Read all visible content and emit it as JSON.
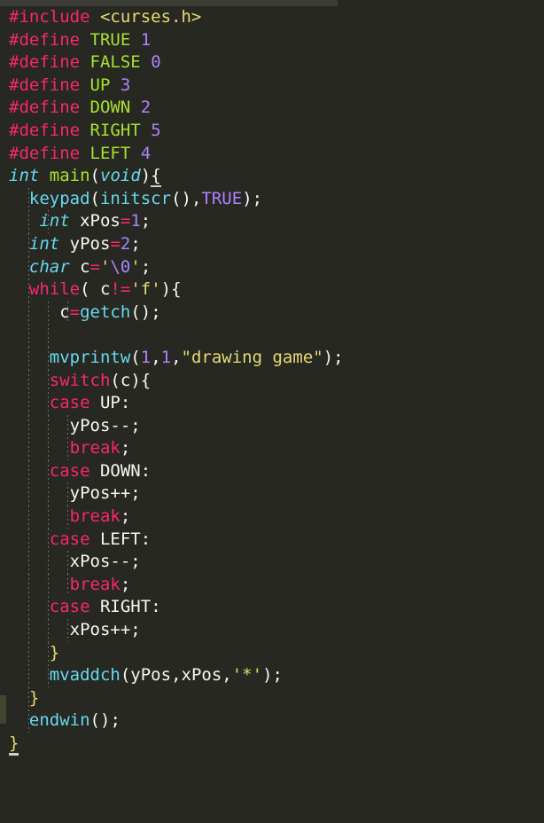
{
  "editor": {
    "theme_name": "monokai",
    "background_color": "#272822",
    "default_text_color": "#f8f8f2",
    "top_strip_color": "#3c3d36",
    "gutter_marker_color": "#43442f",
    "indent_guide_color": "#6e7066",
    "colors": {
      "keyword": "#f92672",
      "type": "#66d9ef",
      "macro_name": "#a6e22e",
      "number": "#ae81ff",
      "function": "#66d9ef",
      "function_def": "#a6e22e",
      "string": "#e6db74",
      "escape": "#ae81ff",
      "identifier": "#f8f8f2",
      "constant": "#ae81ff"
    },
    "language": "c"
  },
  "code": {
    "lines": [
      {
        "indent_guides": [],
        "tokens": [
          {
            "t": "#include",
            "c": "pre"
          },
          {
            "t": " ",
            "c": "id"
          },
          {
            "t": "<curses.h>",
            "c": "hdr"
          }
        ]
      },
      {
        "indent_guides": [],
        "tokens": [
          {
            "t": "#define",
            "c": "pre"
          },
          {
            "t": " ",
            "c": "id"
          },
          {
            "t": "TRUE",
            "c": "mac"
          },
          {
            "t": " ",
            "c": "id"
          },
          {
            "t": "1",
            "c": "num"
          }
        ]
      },
      {
        "indent_guides": [],
        "tokens": [
          {
            "t": "#define",
            "c": "pre"
          },
          {
            "t": " ",
            "c": "id"
          },
          {
            "t": "FALSE",
            "c": "mac"
          },
          {
            "t": " ",
            "c": "id"
          },
          {
            "t": "0",
            "c": "num"
          }
        ]
      },
      {
        "indent_guides": [],
        "tokens": [
          {
            "t": "#define",
            "c": "pre"
          },
          {
            "t": " ",
            "c": "id"
          },
          {
            "t": "UP",
            "c": "mac"
          },
          {
            "t": " ",
            "c": "id"
          },
          {
            "t": "3",
            "c": "num"
          }
        ]
      },
      {
        "indent_guides": [],
        "tokens": [
          {
            "t": "#define",
            "c": "pre"
          },
          {
            "t": " ",
            "c": "id"
          },
          {
            "t": "DOWN",
            "c": "mac"
          },
          {
            "t": " ",
            "c": "id"
          },
          {
            "t": "2",
            "c": "num"
          }
        ]
      },
      {
        "indent_guides": [],
        "tokens": [
          {
            "t": "#define",
            "c": "pre"
          },
          {
            "t": " ",
            "c": "id"
          },
          {
            "t": "RIGHT",
            "c": "mac"
          },
          {
            "t": " ",
            "c": "id"
          },
          {
            "t": "5",
            "c": "num"
          }
        ]
      },
      {
        "indent_guides": [],
        "tokens": [
          {
            "t": "#define",
            "c": "pre"
          },
          {
            "t": " ",
            "c": "id"
          },
          {
            "t": "LEFT",
            "c": "mac"
          },
          {
            "t": " ",
            "c": "id"
          },
          {
            "t": "4",
            "c": "num"
          }
        ]
      },
      {
        "indent_guides": [],
        "tokens": [
          {
            "t": "int",
            "c": "type"
          },
          {
            "t": " ",
            "c": "id"
          },
          {
            "t": "main",
            "c": "fndef"
          },
          {
            "t": "(",
            "c": "punct"
          },
          {
            "t": "void",
            "c": "type"
          },
          {
            "t": ")",
            "c": "punct"
          },
          {
            "t": "{",
            "c": "punct match"
          }
        ]
      },
      {
        "indent_guides": [
          22
        ],
        "tokens": [
          {
            "t": "  ",
            "c": "id"
          },
          {
            "t": "keypad",
            "c": "fn"
          },
          {
            "t": "(",
            "c": "punct"
          },
          {
            "t": "initscr",
            "c": "fn"
          },
          {
            "t": "(",
            "c": "punct"
          },
          {
            "t": ")",
            "c": "punct"
          },
          {
            "t": ",",
            "c": "punct"
          },
          {
            "t": "TRUE",
            "c": "const"
          },
          {
            "t": ")",
            "c": "punct"
          },
          {
            "t": ";",
            "c": "punct"
          }
        ]
      },
      {
        "indent_guides": [
          22,
          44
        ],
        "tokens": [
          {
            "t": "   ",
            "c": "id"
          },
          {
            "t": "int",
            "c": "type"
          },
          {
            "t": " ",
            "c": "id"
          },
          {
            "t": "xPos",
            "c": "id"
          },
          {
            "t": "=",
            "c": "op"
          },
          {
            "t": "1",
            "c": "num"
          },
          {
            "t": ";",
            "c": "punct"
          }
        ]
      },
      {
        "indent_guides": [
          22
        ],
        "tokens": [
          {
            "t": "  ",
            "c": "id"
          },
          {
            "t": "int",
            "c": "type"
          },
          {
            "t": " ",
            "c": "id"
          },
          {
            "t": "yPos",
            "c": "id"
          },
          {
            "t": "=",
            "c": "op"
          },
          {
            "t": "2",
            "c": "num"
          },
          {
            "t": ";",
            "c": "punct"
          }
        ]
      },
      {
        "indent_guides": [
          22
        ],
        "tokens": [
          {
            "t": "  ",
            "c": "id"
          },
          {
            "t": "char",
            "c": "type"
          },
          {
            "t": " ",
            "c": "id"
          },
          {
            "t": "c",
            "c": "id"
          },
          {
            "t": "=",
            "c": "op"
          },
          {
            "t": "'",
            "c": "str"
          },
          {
            "t": "\\0",
            "c": "esc"
          },
          {
            "t": "'",
            "c": "str"
          },
          {
            "t": ";",
            "c": "punct"
          }
        ]
      },
      {
        "indent_guides": [
          22
        ],
        "tokens": [
          {
            "t": "  ",
            "c": "id"
          },
          {
            "t": "while",
            "c": "kw"
          },
          {
            "t": "( ",
            "c": "punct"
          },
          {
            "t": "c",
            "c": "id"
          },
          {
            "t": "!=",
            "c": "op"
          },
          {
            "t": "'f'",
            "c": "str"
          },
          {
            "t": ")",
            "c": "punct"
          },
          {
            "t": "{",
            "c": "punct"
          }
        ]
      },
      {
        "indent_guides": [
          22,
          44,
          66
        ],
        "tokens": [
          {
            "t": "     ",
            "c": "id"
          },
          {
            "t": "c",
            "c": "id"
          },
          {
            "t": "=",
            "c": "op"
          },
          {
            "t": "getch",
            "c": "fn"
          },
          {
            "t": "(",
            "c": "punct"
          },
          {
            "t": ")",
            "c": "punct"
          },
          {
            "t": ";",
            "c": "punct"
          }
        ]
      },
      {
        "indent_guides": [
          22,
          44
        ],
        "tokens": []
      },
      {
        "indent_guides": [
          22,
          44
        ],
        "tokens": [
          {
            "t": "    ",
            "c": "id"
          },
          {
            "t": "mvprintw",
            "c": "fn"
          },
          {
            "t": "(",
            "c": "punct"
          },
          {
            "t": "1",
            "c": "num"
          },
          {
            "t": ",",
            "c": "punct"
          },
          {
            "t": "1",
            "c": "num"
          },
          {
            "t": ",",
            "c": "punct"
          },
          {
            "t": "\"drawing game\"",
            "c": "str"
          },
          {
            "t": ")",
            "c": "punct"
          },
          {
            "t": ";",
            "c": "punct"
          }
        ]
      },
      {
        "indent_guides": [
          22,
          44
        ],
        "tokens": [
          {
            "t": "    ",
            "c": "id"
          },
          {
            "t": "switch",
            "c": "kw"
          },
          {
            "t": "(",
            "c": "punct"
          },
          {
            "t": "c",
            "c": "id"
          },
          {
            "t": ")",
            "c": "punct"
          },
          {
            "t": "{",
            "c": "punct"
          }
        ]
      },
      {
        "indent_guides": [
          22,
          44
        ],
        "tokens": [
          {
            "t": "    ",
            "c": "id"
          },
          {
            "t": "case",
            "c": "kw"
          },
          {
            "t": " ",
            "c": "id"
          },
          {
            "t": "UP",
            "c": "id"
          },
          {
            "t": ":",
            "c": "punct"
          }
        ]
      },
      {
        "indent_guides": [
          22,
          44,
          66
        ],
        "tokens": [
          {
            "t": "      ",
            "c": "id"
          },
          {
            "t": "yPos",
            "c": "id"
          },
          {
            "t": "--",
            "c": "punct"
          },
          {
            "t": ";",
            "c": "punct"
          }
        ]
      },
      {
        "indent_guides": [
          22,
          44,
          66
        ],
        "tokens": [
          {
            "t": "      ",
            "c": "id"
          },
          {
            "t": "break",
            "c": "kw"
          },
          {
            "t": ";",
            "c": "punct"
          }
        ]
      },
      {
        "indent_guides": [
          22,
          44
        ],
        "tokens": [
          {
            "t": "    ",
            "c": "id"
          },
          {
            "t": "case",
            "c": "kw"
          },
          {
            "t": " ",
            "c": "id"
          },
          {
            "t": "DOWN",
            "c": "id"
          },
          {
            "t": ":",
            "c": "punct"
          }
        ]
      },
      {
        "indent_guides": [
          22,
          44,
          66
        ],
        "tokens": [
          {
            "t": "      ",
            "c": "id"
          },
          {
            "t": "yPos",
            "c": "id"
          },
          {
            "t": "++",
            "c": "punct"
          },
          {
            "t": ";",
            "c": "punct"
          }
        ]
      },
      {
        "indent_guides": [
          22,
          44,
          66
        ],
        "tokens": [
          {
            "t": "      ",
            "c": "id"
          },
          {
            "t": "break",
            "c": "kw"
          },
          {
            "t": ";",
            "c": "punct"
          }
        ]
      },
      {
        "indent_guides": [
          22,
          44
        ],
        "tokens": [
          {
            "t": "    ",
            "c": "id"
          },
          {
            "t": "case",
            "c": "kw"
          },
          {
            "t": " ",
            "c": "id"
          },
          {
            "t": "LEFT",
            "c": "id"
          },
          {
            "t": ":",
            "c": "punct"
          }
        ]
      },
      {
        "indent_guides": [
          22,
          44,
          66
        ],
        "tokens": [
          {
            "t": "      ",
            "c": "id"
          },
          {
            "t": "xPos",
            "c": "id"
          },
          {
            "t": "--",
            "c": "punct"
          },
          {
            "t": ";",
            "c": "punct"
          }
        ]
      },
      {
        "indent_guides": [
          22,
          44,
          66
        ],
        "tokens": [
          {
            "t": "      ",
            "c": "id"
          },
          {
            "t": "break",
            "c": "kw"
          },
          {
            "t": ";",
            "c": "punct"
          }
        ]
      },
      {
        "indent_guides": [
          22,
          44
        ],
        "tokens": [
          {
            "t": "    ",
            "c": "id"
          },
          {
            "t": "case",
            "c": "kw"
          },
          {
            "t": " ",
            "c": "id"
          },
          {
            "t": "RIGHT",
            "c": "id"
          },
          {
            "t": ":",
            "c": "punct"
          }
        ]
      },
      {
        "indent_guides": [
          22,
          44,
          66
        ],
        "tokens": [
          {
            "t": "      ",
            "c": "id"
          },
          {
            "t": "xPos",
            "c": "id"
          },
          {
            "t": "++",
            "c": "punct"
          },
          {
            "t": ";",
            "c": "punct"
          }
        ]
      },
      {
        "indent_guides": [
          22,
          44
        ],
        "tokens": [
          {
            "t": "    ",
            "c": "id"
          },
          {
            "t": "}",
            "c": "str"
          }
        ]
      },
      {
        "indent_guides": [
          22,
          44
        ],
        "tokens": [
          {
            "t": "    ",
            "c": "id"
          },
          {
            "t": "mvaddch",
            "c": "fn"
          },
          {
            "t": "(",
            "c": "punct"
          },
          {
            "t": "yPos",
            "c": "id"
          },
          {
            "t": ",",
            "c": "punct"
          },
          {
            "t": "xPos",
            "c": "id"
          },
          {
            "t": ",",
            "c": "punct"
          },
          {
            "t": "'*'",
            "c": "str"
          },
          {
            "t": ")",
            "c": "punct"
          },
          {
            "t": ";",
            "c": "punct"
          }
        ]
      },
      {
        "indent_guides": [
          22
        ],
        "tokens": [
          {
            "t": "  ",
            "c": "id"
          },
          {
            "t": "}",
            "c": "str"
          }
        ]
      },
      {
        "indent_guides": [
          22
        ],
        "tokens": [
          {
            "t": "  ",
            "c": "id"
          },
          {
            "t": "endwin",
            "c": "fn"
          },
          {
            "t": "(",
            "c": "punct"
          },
          {
            "t": ")",
            "c": "punct"
          },
          {
            "t": ";",
            "c": "punct"
          }
        ]
      },
      {
        "indent_guides": [],
        "tokens": [
          {
            "t": "}",
            "c": "str cursor"
          }
        ]
      }
    ]
  }
}
